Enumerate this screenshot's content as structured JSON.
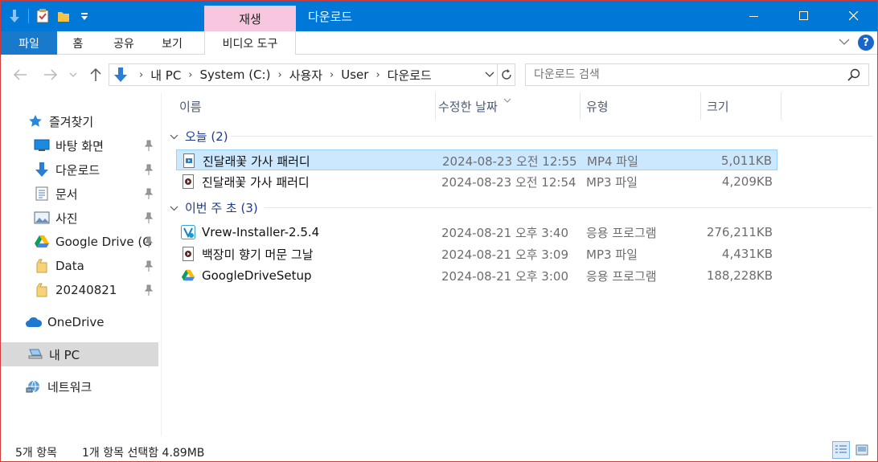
{
  "title_bar": {
    "context_tab_header": "재생",
    "window_title": "다운로드"
  },
  "ribbon": {
    "tabs": [
      "파일",
      "홈",
      "공유",
      "보기",
      "비디오 도구"
    ]
  },
  "address": {
    "crumbs": [
      "내 PC",
      "System (C:)",
      "사용자",
      "User",
      "다운로드"
    ],
    "search_placeholder": "다운로드 검색"
  },
  "nav": {
    "quick_access": "즐겨찾기",
    "items": [
      {
        "label": "바탕 화면",
        "icon": "desktop-icon",
        "pinned": true
      },
      {
        "label": "다운로드",
        "icon": "download-arrow-icon",
        "pinned": true
      },
      {
        "label": "문서",
        "icon": "document-icon",
        "pinned": true
      },
      {
        "label": "사진",
        "icon": "pictures-icon",
        "pinned": true
      },
      {
        "label": "Google Drive (G",
        "icon": "google-drive-icon",
        "pinned": true
      },
      {
        "label": "Data",
        "icon": "folder-icon",
        "pinned": true
      },
      {
        "label": "20240821",
        "icon": "folder-icon",
        "pinned": true
      }
    ],
    "onedrive": "OneDrive",
    "this_pc": "내 PC",
    "network": "네트워크"
  },
  "columns": {
    "name": "이름",
    "date": "수정한 날짜",
    "type": "유형",
    "size": "크기"
  },
  "groups": [
    {
      "label": "오늘 (2)",
      "files": [
        {
          "name": "진달래꽃 가사 패러디",
          "date": "2024-08-23 오전 12:55",
          "type": "MP4 파일",
          "size": "5,011KB",
          "icon": "mp4-video-icon",
          "selected": true
        },
        {
          "name": "진달래꽃 가사 패러디",
          "date": "2024-08-23 오전 12:54",
          "type": "MP3 파일",
          "size": "4,209KB",
          "icon": "mp3-audio-icon",
          "selected": false
        }
      ]
    },
    {
      "label": "이번 주 초 (3)",
      "files": [
        {
          "name": "Vrew-Installer-2.5.4",
          "date": "2024-08-21 오후 3:40",
          "type": "응용 프로그램",
          "size": "276,211KB",
          "icon": "vrew-installer-icon",
          "selected": false
        },
        {
          "name": "백장미 향기 머문 그날",
          "date": "2024-08-21 오후 3:09",
          "type": "MP3 파일",
          "size": "4,431KB",
          "icon": "mp3-audio-icon",
          "selected": false
        },
        {
          "name": "GoogleDriveSetup",
          "date": "2024-08-21 오후 3:00",
          "type": "응용 프로그램",
          "size": "188,228KB",
          "icon": "google-drive-icon",
          "selected": false
        }
      ]
    }
  ],
  "status": {
    "count": "5개 항목",
    "selection": "1개 항목 선택함 4.89MB"
  },
  "colors": {
    "titlebar": "#0078d7",
    "file_tab": "#1979ca",
    "context_tab": "#f7c7e0",
    "selection": "#cce8ff",
    "group_header": "#1e3a8a"
  }
}
